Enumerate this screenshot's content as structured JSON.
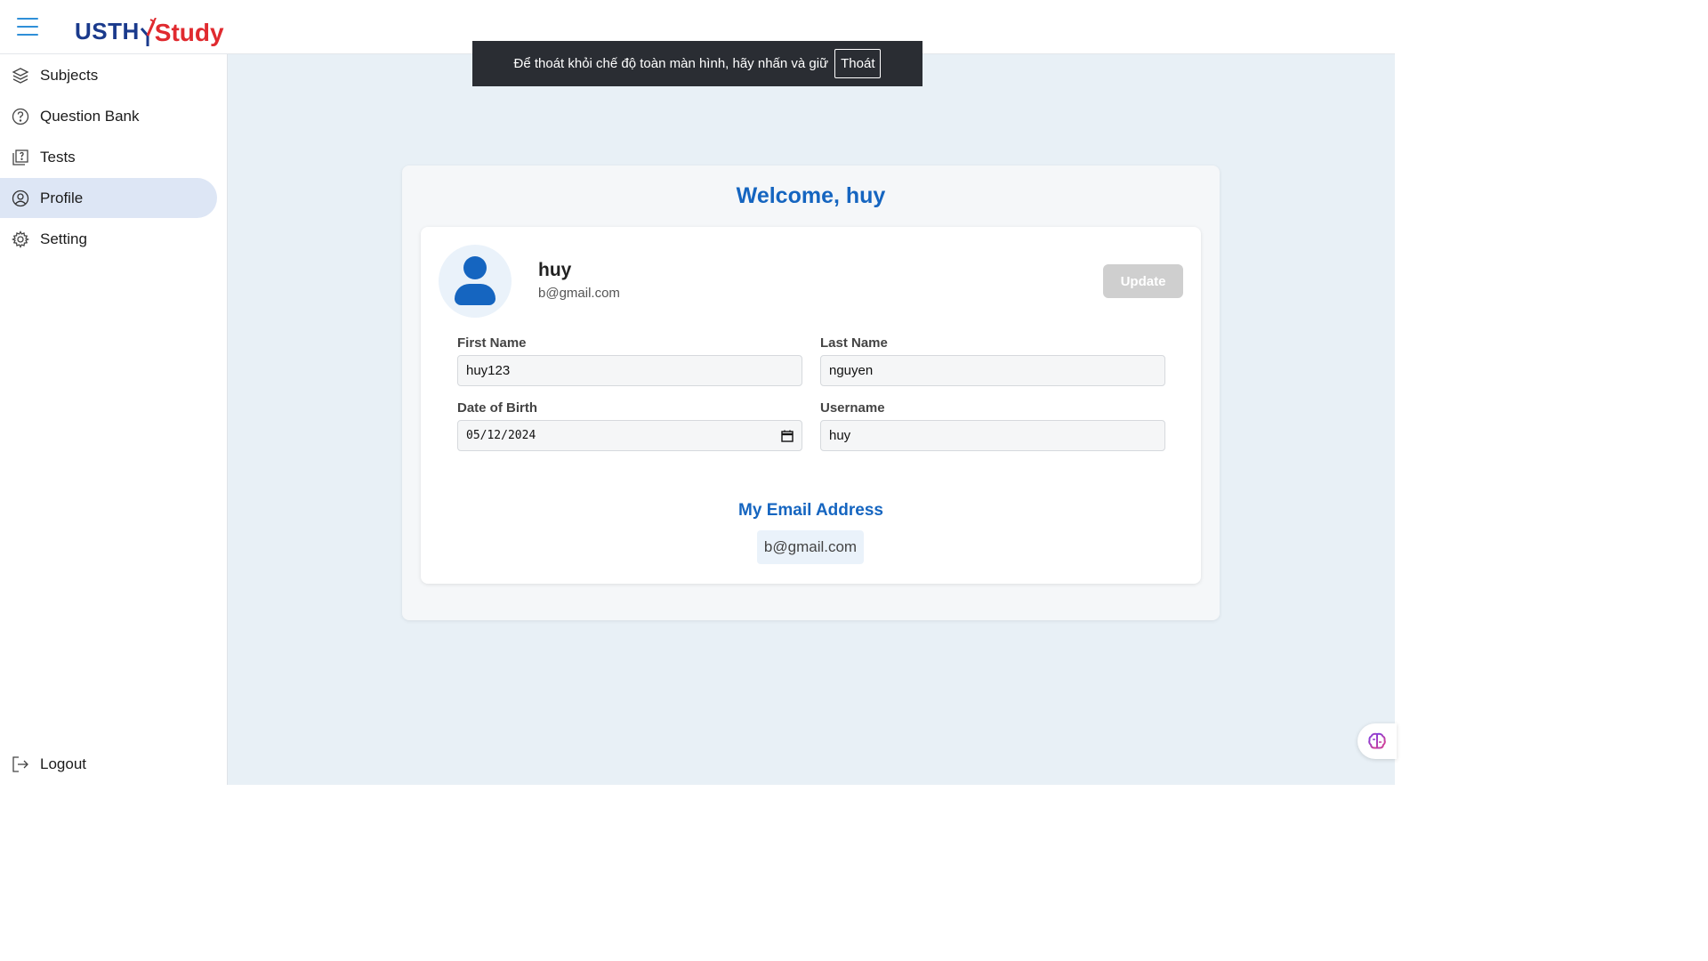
{
  "header": {
    "logo_left": "USTH",
    "logo_right": "Study",
    "menu_icon": "hamburger-icon"
  },
  "toast": {
    "message": "Để thoát khỏi chế độ toàn màn hình, hãy nhấn và giữ",
    "exit_label": "Thoát"
  },
  "sidebar": {
    "items": [
      {
        "label": "Subjects",
        "icon": "layers-icon"
      },
      {
        "label": "Question Bank",
        "icon": "question-circle-icon"
      },
      {
        "label": "Tests",
        "icon": "quiz-icon"
      },
      {
        "label": "Profile",
        "icon": "user-circle-icon",
        "active": true
      },
      {
        "label": "Setting",
        "icon": "gear-icon"
      }
    ],
    "logout_label": "Logout"
  },
  "profile": {
    "welcome": "Welcome, huy",
    "name": "huy",
    "email": "b@gmail.com",
    "update_label": "Update",
    "fields": {
      "first_name_label": "First Name",
      "first_name_value": "huy123",
      "last_name_label": "Last Name",
      "last_name_value": "nguyen",
      "dob_label": "Date of Birth",
      "dob_value": "05/12/2024",
      "username_label": "Username",
      "username_value": "huy"
    },
    "email_heading": "My Email Address",
    "email_value": "b@gmail.com"
  },
  "colors": {
    "primary": "#1565c0",
    "active_nav": "#dde6f5",
    "main_bg": "#e8f0f6",
    "logo_blue": "#1a3a8c",
    "logo_red": "#e02a2f"
  }
}
